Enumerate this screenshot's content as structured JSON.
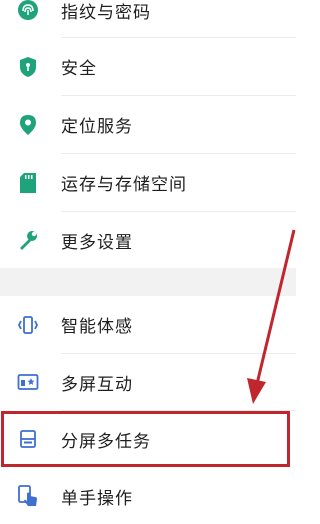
{
  "settings_group_1": {
    "items": [
      {
        "label": "指纹与密码",
        "icon": "fingerprint-icon"
      },
      {
        "label": "安全",
        "icon": "shield-icon"
      },
      {
        "label": "定位服务",
        "icon": "location-pin-icon"
      },
      {
        "label": "运存与存储空间",
        "icon": "sd-card-icon"
      },
      {
        "label": "更多设置",
        "icon": "wrench-icon"
      }
    ]
  },
  "settings_group_2": {
    "items": [
      {
        "label": "智能体感",
        "icon": "motion-sense-icon"
      },
      {
        "label": "多屏互动",
        "icon": "multi-screen-icon"
      },
      {
        "label": "分屏多任务",
        "icon": "split-screen-icon"
      },
      {
        "label": "单手操作",
        "icon": "one-hand-icon"
      }
    ]
  },
  "annotation": {
    "highlight_color": "#c0262d",
    "highlighted_item": "分屏多任务"
  },
  "colors": {
    "green_icon": "#1fa37a",
    "blue_icon": "#3f6fd1"
  }
}
